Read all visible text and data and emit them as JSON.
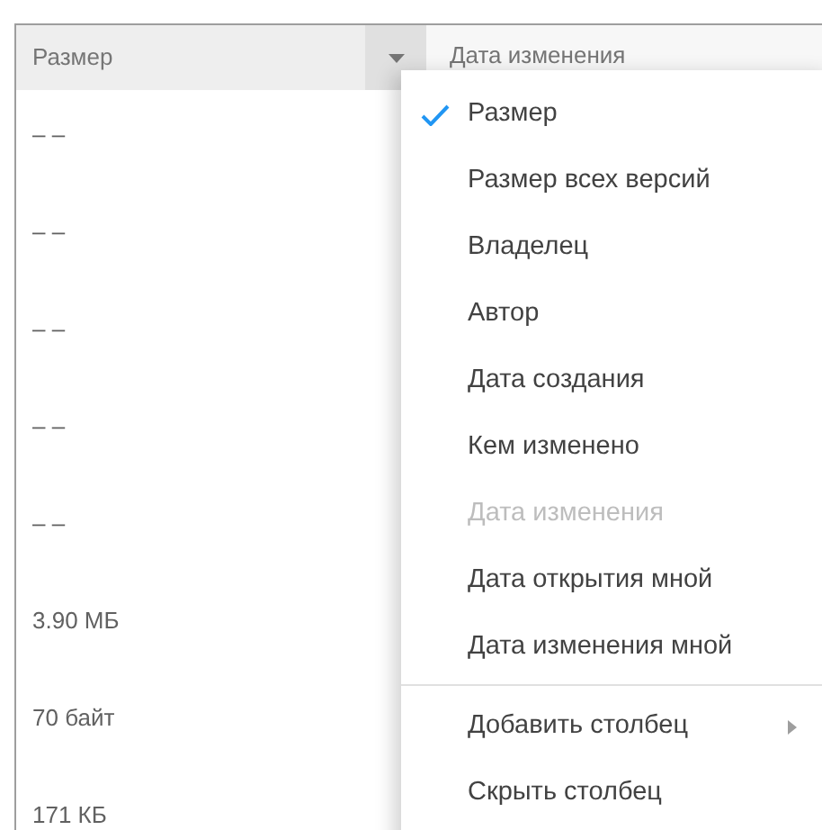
{
  "table": {
    "columns": [
      {
        "label": "Размер",
        "menu_open": true
      },
      {
        "label": "Дата изменения",
        "menu_open": false
      }
    ],
    "rows": [
      {
        "size": "– –"
      },
      {
        "size": "– –"
      },
      {
        "size": "– –"
      },
      {
        "size": "– –"
      },
      {
        "size": "– –"
      },
      {
        "size": "3.90 МБ"
      },
      {
        "size": "70 байт"
      },
      {
        "size": "171 КБ"
      }
    ]
  },
  "column_menu": {
    "options": [
      {
        "label": "Размер",
        "checked": true,
        "disabled": false
      },
      {
        "label": "Размер всех версий",
        "checked": false,
        "disabled": false
      },
      {
        "label": "Владелец",
        "checked": false,
        "disabled": false
      },
      {
        "label": "Автор",
        "checked": false,
        "disabled": false
      },
      {
        "label": "Дата создания",
        "checked": false,
        "disabled": false
      },
      {
        "label": "Кем изменено",
        "checked": false,
        "disabled": false
      },
      {
        "label": "Дата изменения",
        "checked": false,
        "disabled": true
      },
      {
        "label": "Дата открытия мной",
        "checked": false,
        "disabled": false
      },
      {
        "label": "Дата изменения мной",
        "checked": false,
        "disabled": false
      }
    ],
    "actions": [
      {
        "label": "Добавить столбец",
        "submenu": true
      },
      {
        "label": "Скрыть столбец",
        "submenu": false
      }
    ]
  }
}
